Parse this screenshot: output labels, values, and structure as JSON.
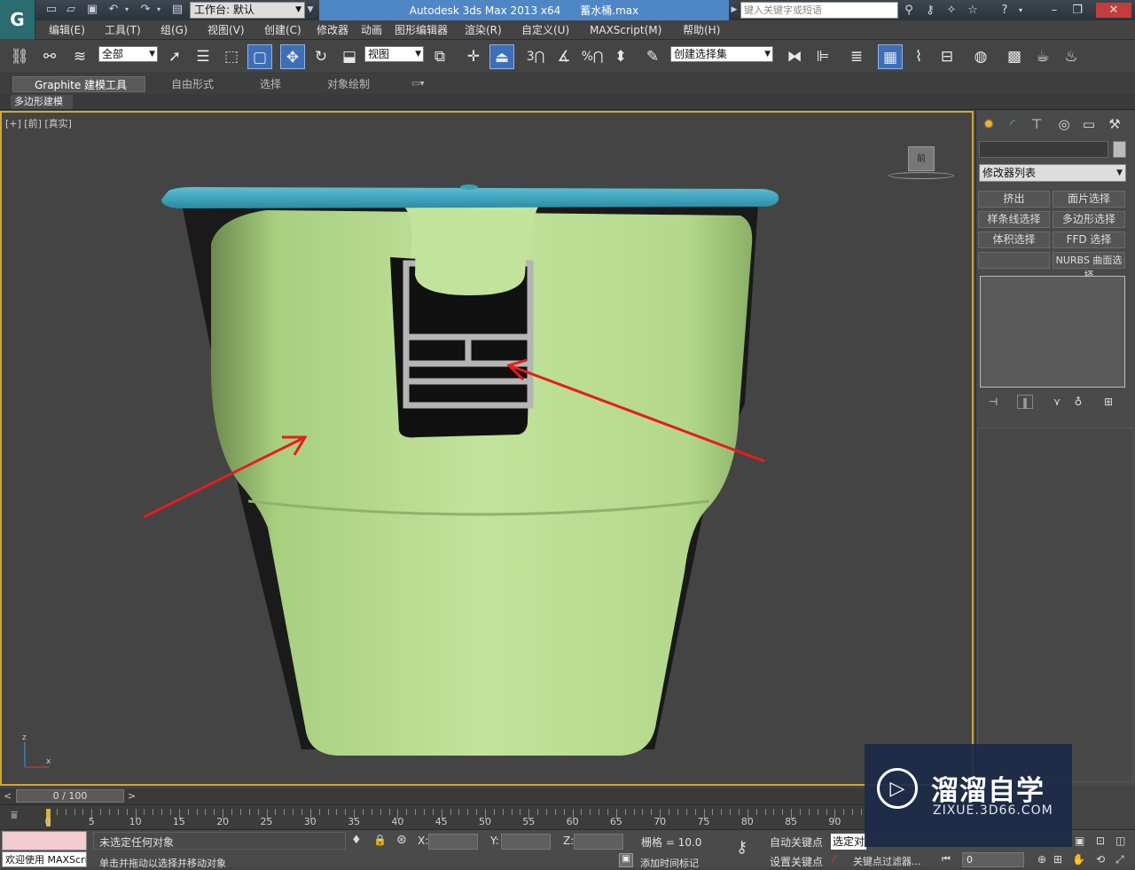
{
  "titlebar": {
    "app_title": "Autodesk 3ds Max  2013 x64",
    "file_name": "蓄水桶.max",
    "workspace_label": "工作台: 默认",
    "search_placeholder": "键入关键字或短语"
  },
  "logo": "G",
  "menu": [
    "编辑(E)",
    "工具(T)",
    "组(G)",
    "视图(V)",
    "创建(C)",
    "修改器",
    "动画",
    "图形编辑器",
    "渲染(R)",
    "自定义(U)",
    "MAXScript(M)",
    "帮助(H)"
  ],
  "toolbar": {
    "selection_filter": "全部",
    "reference_coord": "视图",
    "named_selection": "创建选择集",
    "snap_3": "3",
    "percent": "%"
  },
  "ribbon": {
    "tabs": [
      "Graphite 建模工具",
      "自由形式",
      "选择",
      "对象绘制"
    ],
    "sub_tab": "多边形建模"
  },
  "viewport": {
    "label": "[+] [前] [真实]",
    "viewcube_face": "前",
    "axis_z": "z",
    "axis_x": "x"
  },
  "command_panel": {
    "modifier_list": "修改器列表",
    "buttons": [
      "挤出",
      "面片选择",
      "样条线选择",
      "多边形选择",
      "体积选择",
      "FFD 选择",
      "",
      "NURBS 曲面选择"
    ]
  },
  "timeline": {
    "frame_display": "0 / 100",
    "tick_labels": [
      "0",
      "5",
      "10",
      "15",
      "20",
      "25",
      "30",
      "35",
      "40",
      "45",
      "50",
      "55",
      "60",
      "65",
      "70",
      "75",
      "80",
      "85",
      "90"
    ]
  },
  "status": {
    "welcome": "欢迎使用 MAXScri",
    "selection_status": "未选定任何对象",
    "prompt": "单击并拖动以选择并移动对象",
    "x_label": "X:",
    "y_label": "Y:",
    "z_label": "Z:",
    "grid": "栅格 = 10.0",
    "auto_key": "自动关键点",
    "set_key": "设置关键点",
    "selected_dropdown": "选定对",
    "key_filter": "关键点过滤器...",
    "add_time_tag": "添加时间标记",
    "frame_input": "0"
  },
  "watermark": {
    "title": "溜溜自学",
    "url": "ZIXUE.3D66.COM"
  },
  "colors": {
    "title_blue": "#4f86c6",
    "viewport_border": "#cfa73c",
    "bucket_green": "#b9dd8f",
    "bucket_lid": "#3ba0b8",
    "arrow_red": "#e81c1c"
  }
}
